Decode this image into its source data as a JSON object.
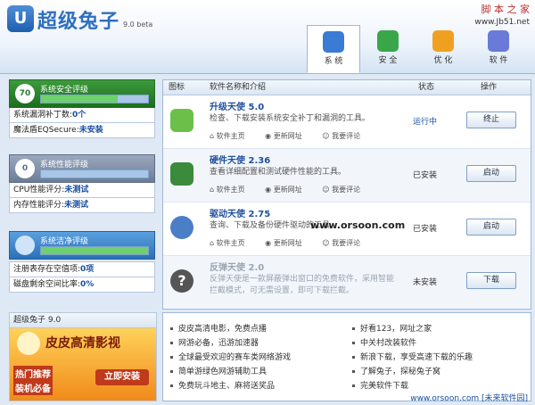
{
  "app": {
    "logo_glyph": "U",
    "title": "超级兔子",
    "version": "9.0 beta"
  },
  "watermark_top": {
    "name": "脚 本 之 家",
    "url": "www.Jb51.net"
  },
  "tabs": [
    {
      "label": "系 统",
      "icon": "system-icon",
      "color": "#3a7bd5"
    },
    {
      "label": "安 全",
      "icon": "security-icon",
      "color": "#3aa64a"
    },
    {
      "label": "优 化",
      "icon": "optimize-icon",
      "color": "#f0a020"
    },
    {
      "label": "软 件",
      "icon": "software-icon",
      "color": "#6a7ad8"
    }
  ],
  "left": {
    "security": {
      "score": "70",
      "title": "系统安全评级",
      "level": 0.72,
      "rows": [
        {
          "label": "系统漏洞补丁数:",
          "value": "0个"
        },
        {
          "label": "魔法盾EQSecure:",
          "value": "未安装"
        }
      ]
    },
    "performance": {
      "score": "0",
      "title": "系统性能评级",
      "level": 0.0,
      "rows": [
        {
          "label": "CPU性能评分:",
          "value": "未测试"
        },
        {
          "label": "内存性能评分:",
          "value": "未测试"
        }
      ]
    },
    "cleanliness": {
      "title": "系统洁净评级",
      "level": 1.0,
      "rows": [
        {
          "label": "注册表存在空值项:",
          "value": "0项"
        },
        {
          "label": "磁盘剩余空间比率:",
          "value": "0%"
        }
      ]
    }
  },
  "promo": {
    "header": "超级兔子 9.0",
    "title": "皮皮高清影视",
    "line1": "热门推荐",
    "line2": "装机必备",
    "button": "立即安装"
  },
  "table": {
    "headers": {
      "icon": "图标",
      "name": "软件名称和介绍",
      "status": "状态",
      "action": "操作"
    },
    "link_labels": {
      "home": "软件主页",
      "update": "更新网址",
      "comment": "我要评论"
    },
    "rows": [
      {
        "name": "升级天使 5.0",
        "desc": "检查、下载安装系统安全补丁和漏洞的工具。",
        "status": "运行中",
        "action": "终止",
        "icon": "upgrade-angel-icon",
        "color": "#6cc04a"
      },
      {
        "name": "硬件天使 2.36",
        "desc": "查看详细配置和测试硬件性能的工具。",
        "status": "已安装",
        "action": "启动",
        "icon": "hardware-angel-icon",
        "color": "#3c8a3c"
      },
      {
        "name": "驱动天使 2.75",
        "desc": "查询、下载及备份硬件驱动的工具。",
        "status": "已安装",
        "action": "启动",
        "icon": "driver-angel-icon",
        "color": "#4a7fc8"
      },
      {
        "name": "反弹天使 2.0",
        "desc": "反弹天使是一款屏蔽弹出窗口的免费软件，采用智能拦截模式，可无需设置，即可下载拦截。",
        "status": "未安装",
        "action": "下载",
        "icon": "question-icon",
        "color": "#555555"
      }
    ]
  },
  "watermark_mid": "www.orsoon.com",
  "links": {
    "left": [
      "皮皮高清电影，免费点播",
      "网游必备，迅游加速器",
      "全球最受欢迎的赛车类网络游戏",
      "简单游绿色网游辅助工具",
      "免费玩斗地主、麻将送奖品"
    ],
    "right": [
      "好看123，网址之家",
      "中关村改装软件",
      "新浪下载，享受高速下载的乐趣",
      "了解兔子，探秘兔子窝",
      "完美软件下载"
    ]
  },
  "footer_site": "www.orsoon.com [未来软件园]"
}
